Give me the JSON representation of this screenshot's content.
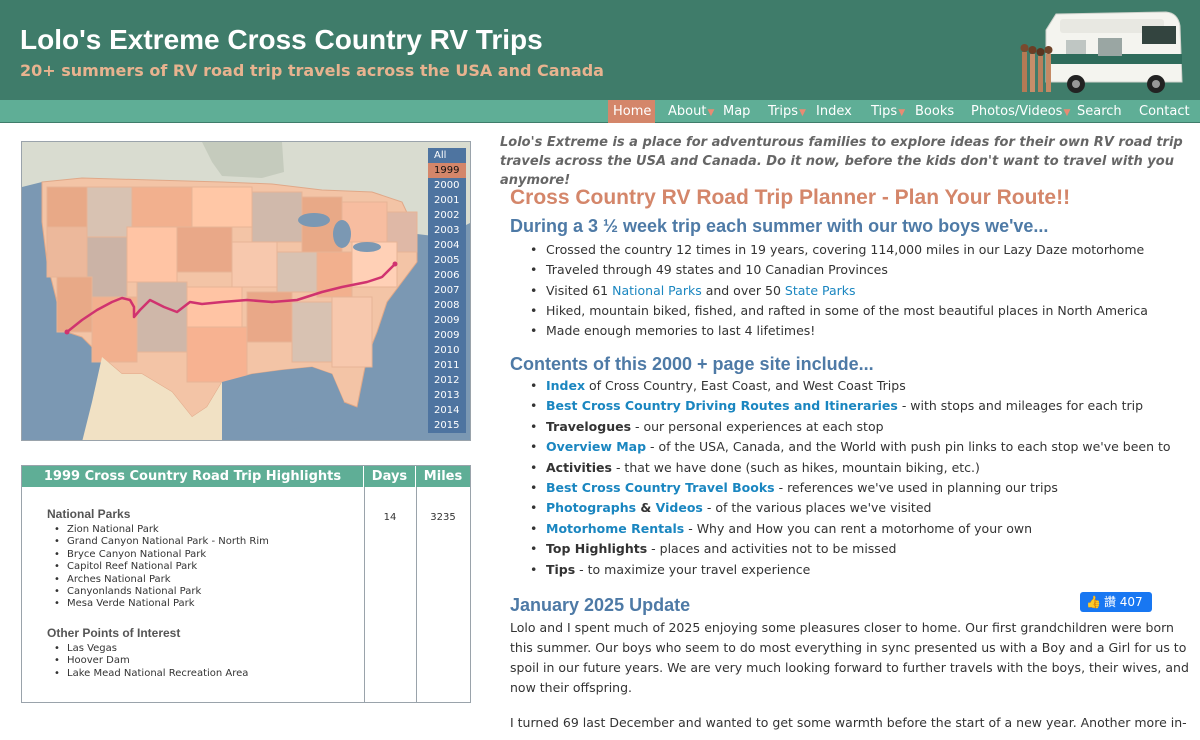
{
  "header": {
    "title": "Lolo's Extreme Cross Country RV Trips",
    "tagline": "20+ summers of RV road trip travels across the USA and Canada"
  },
  "nav": {
    "home": "Home",
    "about": "About",
    "map": "Map",
    "trips": "Trips",
    "index": "Index",
    "tips": "Tips",
    "books": "Books",
    "photos": "Photos/Videos",
    "search": "Search",
    "contact": "Contact"
  },
  "map": {
    "years": [
      "All",
      "1999",
      "2000",
      "2001",
      "2002",
      "2003",
      "2004",
      "2005",
      "2006",
      "2007",
      "2008",
      "2009",
      "2009",
      "2010",
      "2011",
      "2012",
      "2013",
      "2014",
      "2015"
    ],
    "selected_year": "1999",
    "route_color": "#d0336f"
  },
  "highlights": {
    "title": "1999 Cross Country Road Trip Highlights",
    "days_label": "Days",
    "miles_label": "Miles",
    "days": "14",
    "miles": "3235",
    "national_parks_title": "National Parks",
    "national_parks": [
      "Zion National Park",
      "Grand Canyon National Park - North Rim",
      "Bryce Canyon National Park",
      "Capitol Reef National Park",
      "Arches National Park",
      "Canyonlands National Park",
      "Mesa Verde National Park"
    ],
    "other_title": "Other Points of Interest",
    "other": [
      "Las Vegas",
      "Hoover Dam",
      "Lake Mead National Recreation Area"
    ]
  },
  "intro": "Lolo's Extreme is a place for adventurous families to explore ideas for their own RV road trip travels across the USA and Canada. Do it now, before the kids don't want to travel with you anymore!",
  "planner_title": "Cross Country RV Road Trip Planner - Plan Your Route!!",
  "during": {
    "heading": "During a 3 ½ week trip each summer with our two boys we've...",
    "item1": "Crossed the country 12 times in 19 years, covering 114,000 miles in our Lazy Daze motorhome",
    "item2": "Traveled through 49 states and 10 Canadian Provinces",
    "item3_pre": "Visited 61 ",
    "item3_link1": "National Parks",
    "item3_mid": " and over 50 ",
    "item3_link2": "State Parks",
    "item4": "Hiked, mountain biked, fished, and rafted in some of the most beautiful places in North America",
    "item5": "Made enough memories to last 4 lifetimes!"
  },
  "contents": {
    "heading": "Contents of this 2000 + page site include...",
    "index_link": "Index",
    "index_text": " of Cross Country, East Coast, and West Coast Trips",
    "routes_link": "Best Cross Country Driving Routes and Itineraries",
    "routes_text": " - with stops and mileages for each trip",
    "travelogues": "Travelogues",
    "travelogues_text": " - our personal experiences at each stop",
    "overview_link": "Overview Map",
    "overview_text": " - of the USA, Canada, and the World with push pin links to each stop we've been to",
    "activities": "Activities",
    "activities_text": " - that we have done (such as hikes, mountain biking, etc.)",
    "books_link": "Best Cross Country Travel Books",
    "books_text": " - references we've used in planning our trips",
    "photos_link": "Photographs",
    "amp": " & ",
    "videos_link": "Videos",
    "photos_text": " - of the various places we've visited",
    "rentals_link": "Motorhome Rentals",
    "rentals_text": " - Why and How you can rent a motorhome of your own",
    "top": "Top Highlights",
    "top_text": " - places and activities not to be missed",
    "tips": "Tips",
    "tips_text": " - to maximize your travel experience"
  },
  "update": {
    "heading": "January 2025 Update",
    "like_label": "讚 407",
    "para1": "Lolo and I spent much of 2025 enjoying some pleasures closer to home. Our first grandchildren were born this summer. Our boys who seem to do most everything in sync presented us with a Boy and a Girl for us to spoil in our future years. We are very much looking forward to further travels with the boys, their wives, and now their offspring.",
    "para2": "I turned 69 last December and wanted to get some warmth before the start of a new year. Another more in-"
  }
}
